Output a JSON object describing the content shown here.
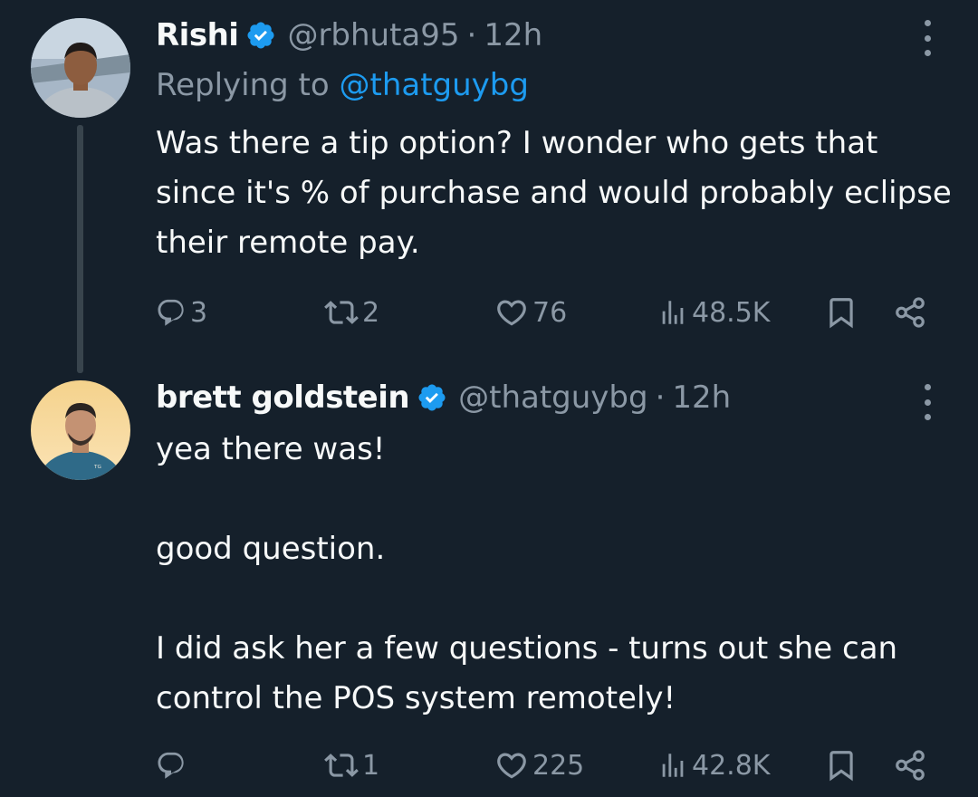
{
  "tweets": [
    {
      "name": "Rishi",
      "handle": "@rbhuta95",
      "separator": "·",
      "time": "12h",
      "replying_prefix": "Replying to",
      "replying_handle": "@thatguybg",
      "paragraphs": [
        "Was there a tip option? I wonder who gets that since it's % of purchase and would probably eclipse their remote pay."
      ],
      "replies": "3",
      "retweets": "2",
      "likes": "76",
      "views": "48.5K"
    },
    {
      "name": "brett goldstein",
      "handle": "@thatguybg",
      "separator": "·",
      "time": "12h",
      "paragraphs": [
        "yea there was!",
        "good question.",
        "I did ask her a few questions - turns out she can control the POS system remotely!"
      ],
      "replies": "",
      "retweets": "1",
      "likes": "225",
      "views": "42.8K"
    }
  ],
  "icons": {
    "verified": "verified-badge-icon",
    "more": "more-options-icon",
    "reply": "reply-icon",
    "retweet": "retweet-icon",
    "like": "heart-icon",
    "views": "views-bar-chart-icon",
    "bookmark": "bookmark-icon",
    "share": "share-icon"
  },
  "colors": {
    "background": "#15202b",
    "text": "#f7f9f9",
    "secondary": "#8b98a5",
    "accent": "#1d9bf0",
    "thread_line": "#38444d"
  }
}
